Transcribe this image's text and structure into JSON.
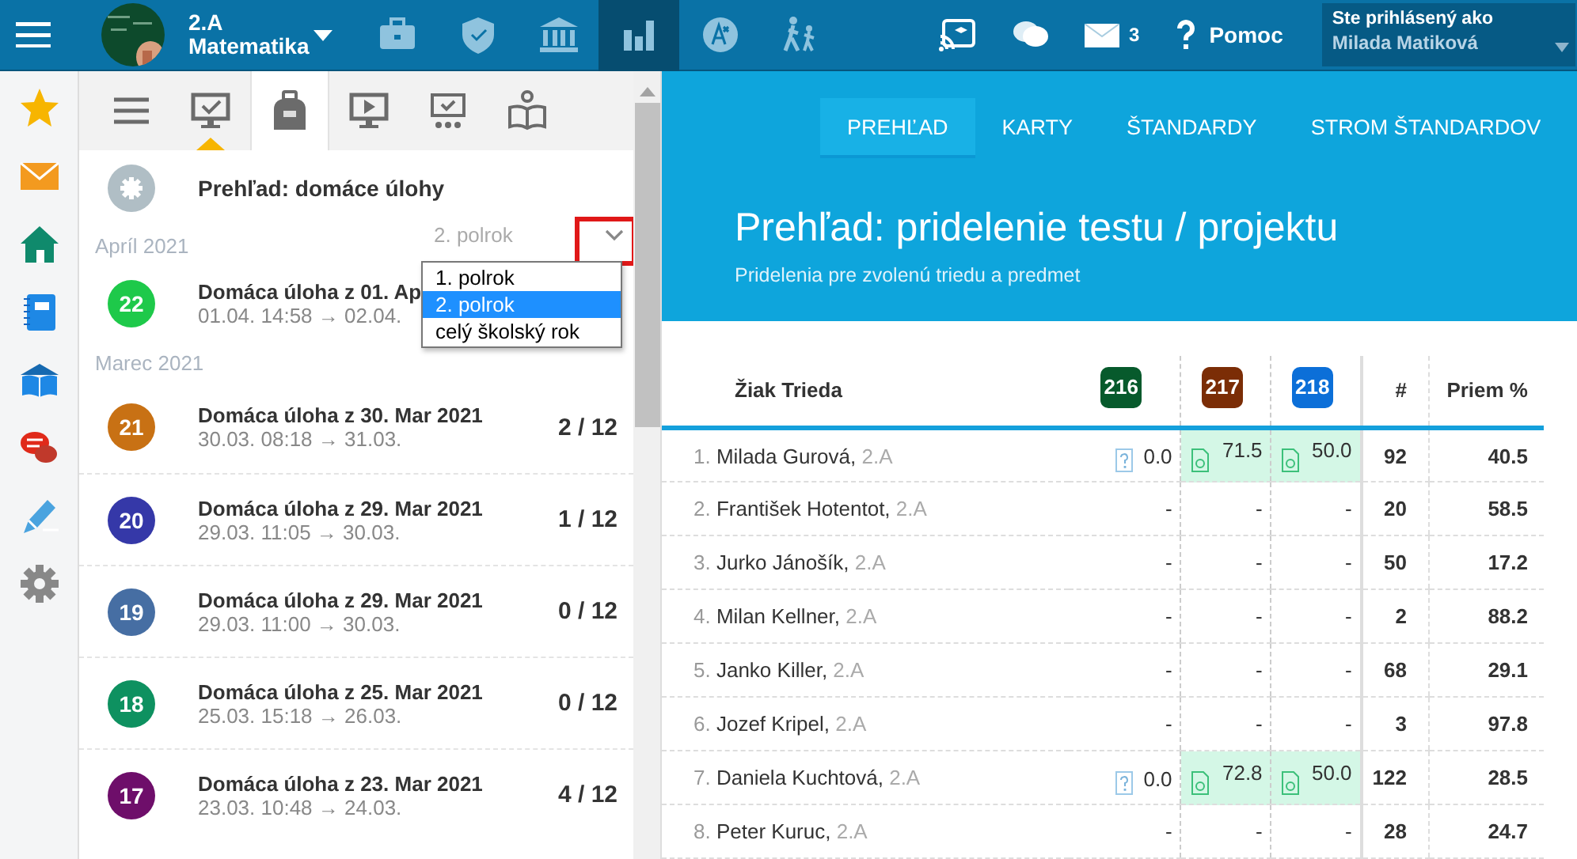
{
  "topbar": {
    "class_name": "2.A",
    "subject": "Matematika",
    "nav": [
      {
        "kind": "briefcase",
        "selected": false
      },
      {
        "kind": "shield",
        "selected": false
      },
      {
        "kind": "bank",
        "selected": false
      },
      {
        "kind": "chart",
        "selected": true
      },
      {
        "kind": "letter",
        "selected": false
      },
      {
        "kind": "walkers",
        "selected": false
      }
    ],
    "tools": [
      {
        "kind": "cast"
      },
      {
        "kind": "chat"
      },
      {
        "kind": "mail",
        "count": "3"
      },
      {
        "kind": "help",
        "label": "Pomoc"
      }
    ],
    "user": {
      "caption": "Ste prihlásený ako",
      "name": "Milada Matiková"
    }
  },
  "rail": [
    {
      "kind": "star"
    },
    {
      "kind": "mail"
    },
    {
      "kind": "home"
    },
    {
      "kind": "notebook"
    },
    {
      "kind": "book"
    },
    {
      "kind": "chat"
    },
    {
      "kind": "pen"
    },
    {
      "kind": "gear"
    }
  ],
  "left_tabs": [
    {
      "kind": "menu",
      "selected": false,
      "flag": false
    },
    {
      "kind": "monitor",
      "selected": false,
      "flag": true
    },
    {
      "kind": "backpack",
      "selected": true,
      "flag": false
    },
    {
      "kind": "play",
      "selected": false,
      "flag": false
    },
    {
      "kind": "monitor-dots",
      "selected": false,
      "flag": false
    },
    {
      "kind": "reader",
      "selected": false,
      "flag": false
    }
  ],
  "list": {
    "title": "Prehľad: domáce úlohy",
    "filter": {
      "value": "2. polrok",
      "options": [
        {
          "label": "1. polrok",
          "selected": false
        },
        {
          "label": "2. polrok",
          "selected": true
        },
        {
          "label": "celý školský rok",
          "selected": false
        }
      ]
    },
    "groups": [
      {
        "month": "Apríl 2021",
        "items": [
          {
            "number": "22",
            "color": "#1ec94a",
            "title": "Domáca úloha z 01. Ap",
            "time": "01.04. 14:58 → 02.04."
          }
        ]
      },
      {
        "month": "Marec 2021",
        "items": [
          {
            "number": "21",
            "color": "#c87114",
            "title": "Domáca úloha z 30. Mar 2021",
            "time": "30.03. 08:18 → 31.03.",
            "count": "2 / 12"
          },
          {
            "number": "20",
            "color": "#3538a8",
            "title": "Domáca úloha z 29. Mar 2021",
            "time": "29.03. 11:05 → 30.03.",
            "count": "1 / 12"
          },
          {
            "number": "19",
            "color": "#466ea3",
            "title": "Domáca úloha z 29. Mar 2021",
            "time": "29.03. 11:00 → 30.03.",
            "count": "0 / 12"
          },
          {
            "number": "18",
            "color": "#0e9160",
            "title": "Domáca úloha z 25. Mar 2021",
            "time": "25.03. 15:18 → 26.03.",
            "count": "0 / 12"
          },
          {
            "number": "17",
            "color": "#6e0e6a",
            "title": "Domáca úloha z 23. Mar 2021",
            "time": "23.03. 10:48 → 24.03.",
            "count": "4 / 12"
          }
        ]
      }
    ]
  },
  "tabs": [
    {
      "label": "PREHĽAD",
      "selected": true
    },
    {
      "label": "KARTY",
      "selected": false
    },
    {
      "label": "ŠTANDARDY",
      "selected": false
    },
    {
      "label": "STROM ŠTANDARDOV",
      "selected": false
    }
  ],
  "header": {
    "title": "Prehľad: pridelenie testu / projektu",
    "subtitle": "Pridelenia pre zvolenú triedu a predmet"
  },
  "table": {
    "name_column": "Žiak Trieda",
    "tests": [
      {
        "label": "216",
        "color": "#075a2c"
      },
      {
        "label": "217",
        "color": "#7b2d06"
      },
      {
        "label": "218",
        "color": "#0c6fd8"
      }
    ],
    "count_column": "#",
    "avg_column": "Priem %",
    "rows": [
      {
        "index": "1.",
        "name": "Milada Gurová,",
        "class": "2.A",
        "scores": [
          {
            "kind": "quiz",
            "text": "0.0"
          },
          {
            "kind": "file",
            "text": "71.5"
          },
          {
            "kind": "file",
            "text": "50.0"
          }
        ],
        "count": "92",
        "avg": "40.5"
      },
      {
        "index": "2.",
        "name": "František Hotentot,",
        "class": "2.A",
        "scores": [
          {
            "kind": "none",
            "text": "-"
          },
          {
            "kind": "none",
            "text": "-"
          },
          {
            "kind": "none",
            "text": "-"
          }
        ],
        "count": "20",
        "avg": "58.5"
      },
      {
        "index": "3.",
        "name": "Jurko Jánošík,",
        "class": "2.A",
        "scores": [
          {
            "kind": "none",
            "text": "-"
          },
          {
            "kind": "none",
            "text": "-"
          },
          {
            "kind": "none",
            "text": "-"
          }
        ],
        "count": "50",
        "avg": "17.2"
      },
      {
        "index": "4.",
        "name": "Milan Kellner,",
        "class": "2.A",
        "scores": [
          {
            "kind": "none",
            "text": "-"
          },
          {
            "kind": "none",
            "text": "-"
          },
          {
            "kind": "none",
            "text": "-"
          }
        ],
        "count": "2",
        "avg": "88.2"
      },
      {
        "index": "5.",
        "name": "Janko Killer,",
        "class": "2.A",
        "scores": [
          {
            "kind": "none",
            "text": "-"
          },
          {
            "kind": "none",
            "text": "-"
          },
          {
            "kind": "none",
            "text": "-"
          }
        ],
        "count": "68",
        "avg": "29.1"
      },
      {
        "index": "6.",
        "name": "Jozef Kripel,",
        "class": "2.A",
        "scores": [
          {
            "kind": "none",
            "text": "-"
          },
          {
            "kind": "none",
            "text": "-"
          },
          {
            "kind": "none",
            "text": "-"
          }
        ],
        "count": "3",
        "avg": "97.8"
      },
      {
        "index": "7.",
        "name": "Daniela Kuchtová,",
        "class": "2.A",
        "scores": [
          {
            "kind": "quiz",
            "text": "0.0"
          },
          {
            "kind": "file",
            "text": "72.8"
          },
          {
            "kind": "file",
            "text": "50.0"
          }
        ],
        "count": "122",
        "avg": "28.5"
      },
      {
        "index": "8.",
        "name": "Peter Kuruc,",
        "class": "2.A",
        "scores": [
          {
            "kind": "none",
            "text": "-"
          },
          {
            "kind": "none",
            "text": "-"
          },
          {
            "kind": "none",
            "text": "-"
          }
        ],
        "count": "28",
        "avg": "24.7"
      }
    ]
  }
}
